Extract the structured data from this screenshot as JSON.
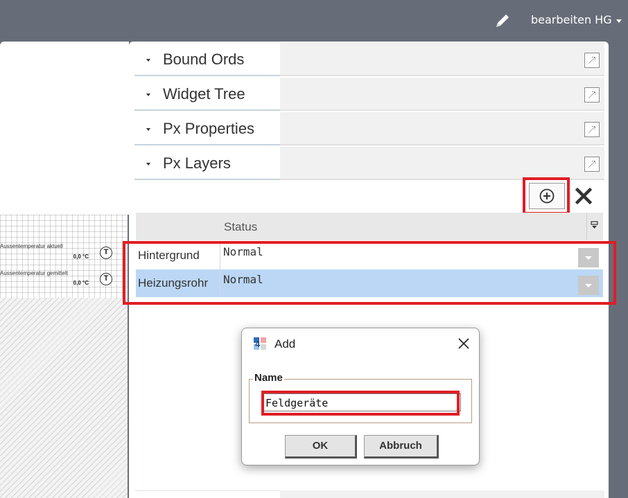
{
  "topbar": {
    "pencil_icon": "pencil-icon",
    "user_label": "bearbeiten HG"
  },
  "canvas": {
    "rows": [
      {
        "label": "Aussentemperatur aktuell",
        "value": "0,0 °C",
        "icon_text": "T"
      },
      {
        "label": "Aussentemperatur gemittelt",
        "value": "0,0 °C",
        "icon_text": "T"
      }
    ]
  },
  "sidebar": {
    "sections": [
      {
        "title": "Bound Ords"
      },
      {
        "title": "Widget Tree"
      },
      {
        "title": "Px Properties"
      },
      {
        "title": "Px Layers"
      }
    ]
  },
  "layers": {
    "toolbar": {
      "add_icon": "plus-circle-icon",
      "delete_icon": "close-x-icon"
    },
    "columns": {
      "status": "Status"
    },
    "rows": [
      {
        "name": "Hintergrund",
        "status": "Normal",
        "selected": false
      },
      {
        "name": "Heizungsrohr",
        "status": "Normal",
        "selected": true
      }
    ]
  },
  "dialog": {
    "title": "Add",
    "group_label": "Name",
    "name_value": "Feldgeräte",
    "ok_label": "OK",
    "cancel_label": "Abbruch"
  },
  "colors": {
    "highlight": "#e01e25",
    "selected_row": "#bcd7f5",
    "topbar": "#676d78"
  }
}
